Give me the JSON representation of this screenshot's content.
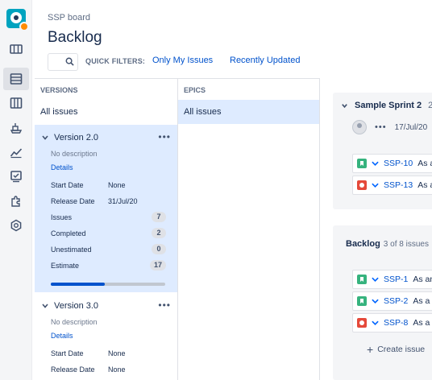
{
  "header": {
    "breadcrumb": "SSP board",
    "title": "Backlog",
    "quick_filters_label": "QUICK FILTERS:",
    "quick_filters": [
      "Only My Issues",
      "Recently Updated"
    ]
  },
  "rail": {
    "icons": [
      "app-logo",
      "board-icon",
      "backlog-icon",
      "columns-icon",
      "releases-icon",
      "reports-icon",
      "issues-icon",
      "add-ons-icon",
      "settings-icon"
    ],
    "active": "backlog-icon"
  },
  "versions_panel": {
    "heading": "VERSIONS",
    "all_issues": "All issues",
    "versions": [
      {
        "name": "Version 2.0",
        "description": "No description",
        "details_link": "Details",
        "start_date_label": "Start Date",
        "start_date": "None",
        "release_date_label": "Release Date",
        "release_date": "31/Jul/20",
        "issues_label": "Issues",
        "issues": "7",
        "completed_label": "Completed",
        "completed": "2",
        "unestimated_label": "Unestimated",
        "unestimated": "0",
        "estimate_label": "Estimate",
        "estimate": "17",
        "progress_fraction": 0.47
      },
      {
        "name": "Version 3.0",
        "description": "No description",
        "details_link": "Details",
        "start_date_label": "Start Date",
        "start_date": "None",
        "release_date_label": "Release Date",
        "release_date": "None"
      }
    ]
  },
  "epics_panel": {
    "heading": "EPICS",
    "all_issues": "All issues"
  },
  "sprint": {
    "name": "Sample Sprint 2",
    "count_fragment": "2",
    "more": "•••",
    "date": "17/Jul/20",
    "issues": [
      {
        "type": "story",
        "key": "SSP-10",
        "summary": "As a"
      },
      {
        "type": "bug",
        "key": "SSP-13",
        "summary": "As a"
      }
    ]
  },
  "backlog": {
    "title": "Backlog",
    "count": "3 of 8 issues",
    "issues": [
      {
        "type": "story",
        "key": "SSP-1",
        "summary": "As an"
      },
      {
        "type": "story",
        "key": "SSP-2",
        "summary": "As a p"
      },
      {
        "type": "bug",
        "key": "SSP-8",
        "summary": "As a p"
      }
    ],
    "create_label": "Create issue"
  },
  "colors": {
    "accent": "#0052cc",
    "selected_bg": "#deebff",
    "story": "#36b37e",
    "bug": "#e5493a"
  }
}
